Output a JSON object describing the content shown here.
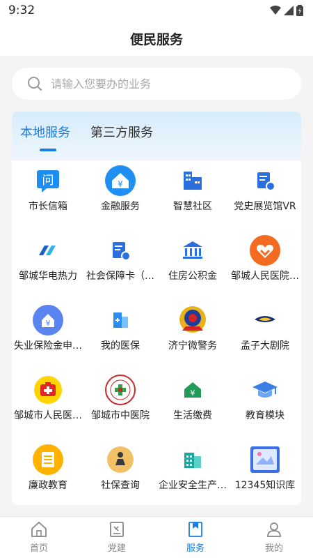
{
  "status_bar": {
    "time": "9:32"
  },
  "page_title": "便民服务",
  "search": {
    "placeholder": "请输入您要办的业务"
  },
  "tabs": [
    {
      "label": "本地服务",
      "active": true
    },
    {
      "label": "第三方服务",
      "active": false
    }
  ],
  "services": [
    {
      "label": "市长信箱",
      "icon": "mailbox-question-icon"
    },
    {
      "label": "金融服务",
      "icon": "yuan-home-icon"
    },
    {
      "label": "智慧社区",
      "icon": "buildings-icon"
    },
    {
      "label": "党史展览馆VR",
      "icon": "document-badge-icon"
    },
    {
      "label": "邹城华电热力",
      "icon": "huadian-logo-icon"
    },
    {
      "label": "社会保障卡（…",
      "icon": "social-card-icon"
    },
    {
      "label": "住房公积金",
      "icon": "bank-building-icon"
    },
    {
      "label": "邹城人民医院…",
      "icon": "hospital-heart-icon"
    },
    {
      "label": "失业保险金申…",
      "icon": "unemployment-yuan-icon"
    },
    {
      "label": "我的医保",
      "icon": "medical-insurance-icon"
    },
    {
      "label": "济宁微警务",
      "icon": "police-emblem-icon"
    },
    {
      "label": "孟子大剧院",
      "icon": "theater-logo-icon"
    },
    {
      "label": "邹城市人民医…",
      "icon": "first-aid-kit-icon"
    },
    {
      "label": "邹城市中医院",
      "icon": "tcm-hospital-seal-icon"
    },
    {
      "label": "生活缴费",
      "icon": "payment-house-icon"
    },
    {
      "label": "教育模块",
      "icon": "graduation-cap-icon"
    },
    {
      "label": "廉政教育",
      "icon": "clipboard-icon"
    },
    {
      "label": "社保查询",
      "icon": "person-query-icon"
    },
    {
      "label": "企业安全生产…",
      "icon": "enterprise-building-icon"
    },
    {
      "label": "12345知识库",
      "icon": "knowledge-base-icon"
    }
  ],
  "bottom_nav": [
    {
      "label": "首页",
      "icon": "home-icon",
      "active": false
    },
    {
      "label": "党建",
      "icon": "party-building-icon",
      "active": false
    },
    {
      "label": "服务",
      "icon": "service-bookmark-icon",
      "active": true
    },
    {
      "label": "我的",
      "icon": "profile-icon",
      "active": false
    }
  ],
  "colors": {
    "accent": "#1a7de0",
    "inactive": "#888888",
    "tab_gradient_top": "#d7ecfb"
  }
}
